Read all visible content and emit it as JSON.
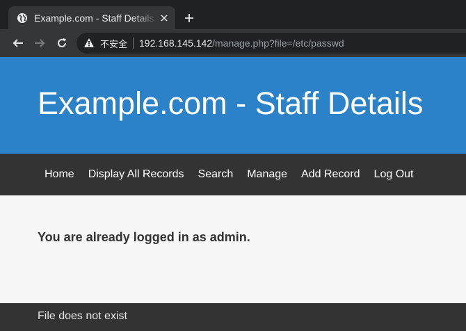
{
  "browser": {
    "tab_title": "Example.com - Staff Details",
    "security_label": "不安全",
    "url_host": "192.168.145.142",
    "url_path": "/manage.php?file=/etc/passwd",
    "icons": {
      "tab": "globe-icon",
      "close": "close-icon",
      "new_tab": "plus-icon",
      "back": "back-arrow-icon",
      "forward": "forward-arrow-icon",
      "reload": "reload-icon",
      "security": "warning-icon"
    }
  },
  "site": {
    "banner_title": "Example.com - Staff Details",
    "nav": [
      {
        "label": "Home"
      },
      {
        "label": "Display All Records"
      },
      {
        "label": "Search"
      },
      {
        "label": "Manage"
      },
      {
        "label": "Add Record"
      },
      {
        "label": "Log Out"
      }
    ],
    "message": "You are already logged in as admin.",
    "footer_text": "File does not exist"
  },
  "colors": {
    "banner": "#2b82c9",
    "nav_bg": "#333333",
    "page_bg": "#f7f7f7"
  }
}
